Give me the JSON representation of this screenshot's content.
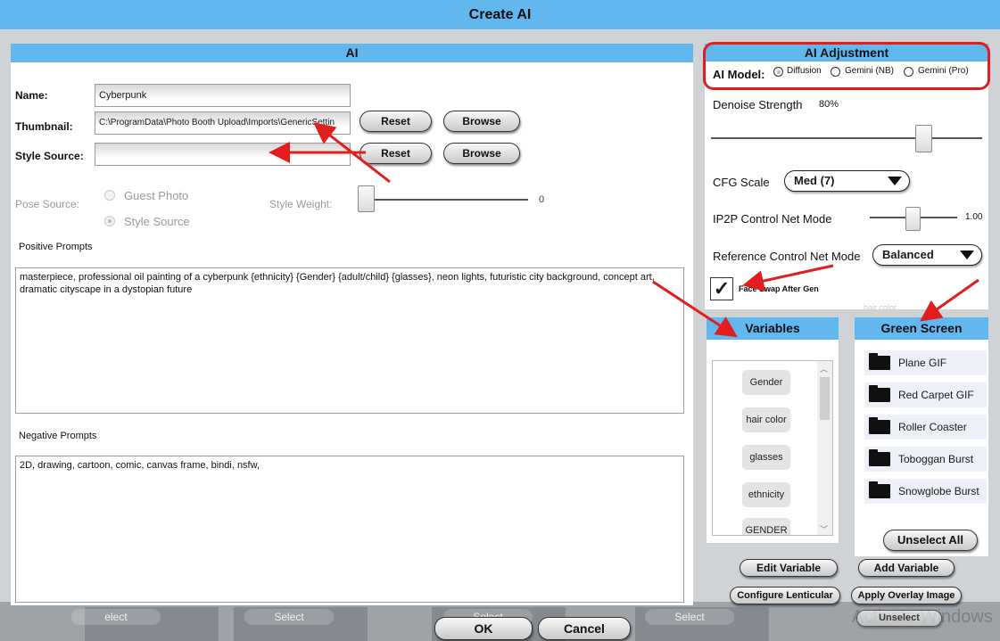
{
  "window": {
    "title": "Create AI"
  },
  "background": {
    "select_labels": [
      "elect",
      "Select",
      "Select",
      "Select",
      "Select"
    ],
    "watermark": "Activate Windows"
  },
  "ai_panel": {
    "header": "AI",
    "name_label": "Name:",
    "name_value": "Cyberpunk",
    "thumbnail_label": "Thumbnail:",
    "thumbnail_value": "C:\\ProgramData\\Photo Booth Upload\\Imports\\GenericSettin",
    "style_source_label": "Style Source:",
    "style_source_value": "",
    "reset_label": "Reset",
    "browse_label": "Browse",
    "pose_source_label": "Pose Source:",
    "pose_options": [
      "Guest Photo",
      "Style Source"
    ],
    "style_weight_label": "Style Weight:",
    "style_weight_value": "0",
    "positive_label": "Positive Prompts",
    "positive_text": "masterpiece, professional oil painting of a cyberpunk {ethnicity} {Gender} {adult/child} {glasses}, neon lights, futuristic city background, concept art, dramatic cityscape in a dystopian future",
    "negative_label": "Negative Prompts",
    "negative_text": "2D, drawing, cartoon, comic, canvas frame, bindi, nsfw,"
  },
  "adjust_panel": {
    "header": "AI Adjustment",
    "model_label": "AI Model:",
    "models": [
      "Diffusion",
      "Gemini (NB)",
      "Gemini (Pro)"
    ],
    "selected_model": "Diffusion",
    "denoise_label": "Denoise Strength",
    "denoise_value": "80%",
    "cfg_label": "CFG Scale",
    "cfg_value": "Med (7)",
    "ip2p_label": "IP2P Control Net Mode",
    "ip2p_value": "1.00",
    "ref_label": "Reference Control Net Mode",
    "ref_value": "Balanced",
    "face_swap_label": "Face Swap After Gen",
    "face_swap_checked": true,
    "hidden_hint": "hair color"
  },
  "variables": {
    "header": "Variables",
    "items": [
      "Gender",
      "hair color",
      "glasses",
      "ethnicity",
      "GENDER"
    ]
  },
  "green_screen": {
    "header": "Green Screen",
    "items": [
      "Plane GIF",
      "Red Carpet GIF",
      "Roller Coaster GIF",
      "Toboggan Burst",
      "Snowglobe Burst"
    ],
    "unselect_label": "Unselect All"
  },
  "actions": {
    "edit_variable": "Edit Variable",
    "add_variable": "Add Variable",
    "configure_lenticular": "Configure Lenticular",
    "apply_overlay": "Apply Overlay Image",
    "unselect": "Unselect",
    "ok": "OK",
    "cancel": "Cancel"
  },
  "colors": {
    "header_blue": "#63b7ef",
    "annotation_red": "#e11d1d"
  }
}
